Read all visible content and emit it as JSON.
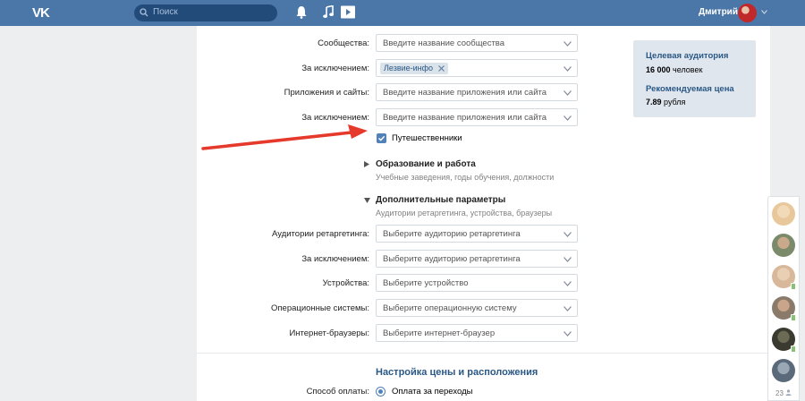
{
  "topbar": {
    "logo": "VK",
    "search_placeholder": "Поиск",
    "user_name": "Дмитрий"
  },
  "form": {
    "rows_top": [
      {
        "label": "Сообщества:",
        "placeholder": "Введите название сообщества"
      },
      {
        "label": "За исключением:",
        "tag": "Лезвие-инфо",
        "placeholder": ""
      },
      {
        "label": "Приложения и сайты:",
        "placeholder": "Введите название приложения или сайта"
      },
      {
        "label": "За исключением:",
        "placeholder": "Введите название приложения или сайта"
      }
    ],
    "checkbox_label": "Путешественники",
    "checkbox_checked": true,
    "education": {
      "title": "Образование и работа",
      "subtitle": "Учебные заведения, годы обучения, должности"
    },
    "extra": {
      "title": "Дополнительные параметры",
      "subtitle": "Аудитории ретаргетинга, устройства, браузеры"
    },
    "rows_bottom": [
      {
        "label": "Аудитории ретаргетинга:",
        "placeholder": "Выберите аудиторию ретаргетинга"
      },
      {
        "label": "За исключением:",
        "placeholder": "Выберите аудиторию ретаргетинга"
      },
      {
        "label": "Устройства:",
        "placeholder": "Выберите устройство"
      },
      {
        "label": "Операционные системы:",
        "placeholder": "Выберите операционную систему"
      },
      {
        "label": "Интернет-браузеры:",
        "placeholder": "Выберите интернет-браузер"
      }
    ],
    "price_heading": "Настройка цены и расположения",
    "payment_label": "Способ оплаты:",
    "payment_option": "Оплата за переходы"
  },
  "audience_box": {
    "target_title": "Целевая аудитория",
    "target_number": "16 000",
    "target_unit": "человек",
    "price_title": "Рекомендуемая цена",
    "price_number": "7.89",
    "price_unit": "рубля"
  },
  "friends_panel": {
    "count": "23",
    "avatars": [
      {
        "online": false,
        "color": "#e8c89a"
      },
      {
        "online": false,
        "color": "#7a8a6a"
      },
      {
        "online": true,
        "color": "#d8b89a"
      },
      {
        "online": true,
        "color": "#8a7a6a"
      },
      {
        "online": true,
        "color": "#3a3a30"
      },
      {
        "online": false,
        "color": "#5a6a7a"
      }
    ]
  },
  "colors": {
    "header": "#4a76a8",
    "accent": "#5181b8",
    "link": "#2a5885",
    "arrow": "#e5392b"
  }
}
